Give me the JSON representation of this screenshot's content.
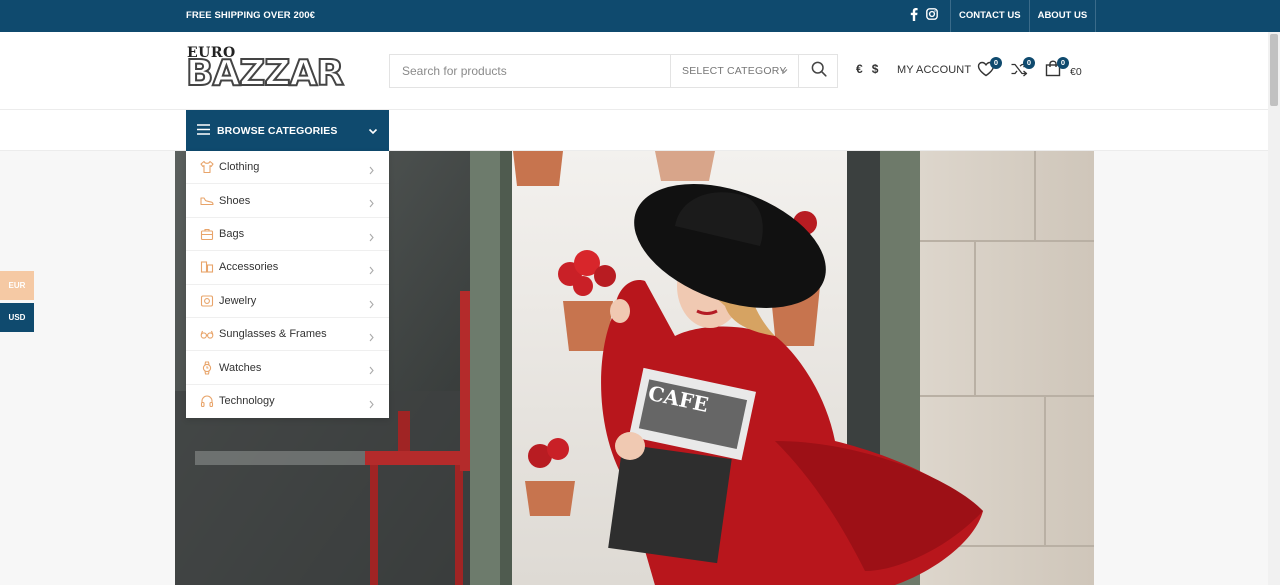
{
  "topbar": {
    "shipping_text": "FREE SHIPPING OVER 200€",
    "social": [
      "facebook-icon",
      "instagram-icon"
    ],
    "links": [
      "CONTACT US",
      "ABOUT US"
    ]
  },
  "header": {
    "logo_top": "EURO",
    "logo_main": "BAZZAR",
    "search_placeholder": "Search for products",
    "select_category": "SELECT CATEGORY",
    "currency_eur": "€",
    "currency_usd": "$",
    "my_account": "MY ACCOUNT",
    "wishlist_count": "0",
    "compare_count": "0",
    "cart_count": "0",
    "cart_total": "€0"
  },
  "nav": {
    "browse_label": "BROWSE CATEGORIES"
  },
  "categories": [
    {
      "label": "Clothing",
      "icon": "clothing-icon"
    },
    {
      "label": "Shoes",
      "icon": "shoe-icon"
    },
    {
      "label": "Bags",
      "icon": "bag-icon"
    },
    {
      "label": "Accessories",
      "icon": "accessories-icon"
    },
    {
      "label": "Jewelry",
      "icon": "jewelry-icon"
    },
    {
      "label": "Sunglasses & Frames",
      "icon": "sunglasses-icon"
    },
    {
      "label": "Watches",
      "icon": "watch-icon"
    },
    {
      "label": "Technology",
      "icon": "headphones-icon"
    }
  ],
  "currency_switcher": {
    "eur": "EUR",
    "usd": "USD"
  },
  "colors": {
    "brand": "#0f4a6e",
    "accent_peach": "#f5c9a4",
    "category_icon": "#e8a46a"
  }
}
